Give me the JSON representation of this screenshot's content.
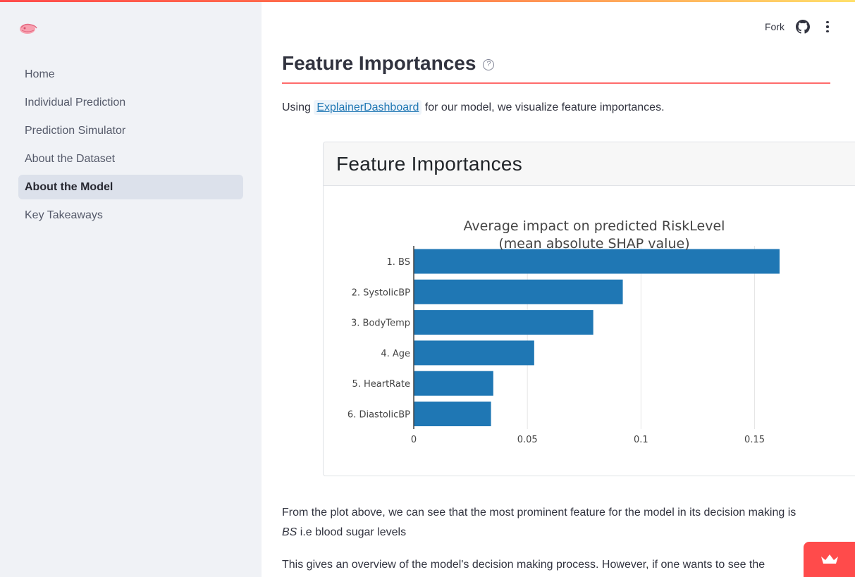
{
  "header": {
    "fork_label": "Fork"
  },
  "sidebar": {
    "items": [
      {
        "label": "Home",
        "active": false
      },
      {
        "label": "Individual Prediction",
        "active": false
      },
      {
        "label": "Prediction Simulator",
        "active": false
      },
      {
        "label": "About the Dataset",
        "active": false
      },
      {
        "label": "About the Model",
        "active": true
      },
      {
        "label": "Key Takeaways",
        "active": false
      }
    ]
  },
  "main": {
    "title": "Feature Importances",
    "help_glyph": "?",
    "intro_prefix": "Using",
    "intro_link": "ExplainerDashboard",
    "intro_suffix": "for our model, we visualize feature importances.",
    "card_title": "Feature Importances",
    "paragraph1_text": "From the plot above, we can see that the most prominent feature for the model in its decision making is",
    "paragraph1_em": "BS",
    "paragraph1_tail": "i.e blood sugar levels",
    "paragraph2": "This gives an overview of the model's decision making process. However, if one wants to see the"
  },
  "colors": {
    "accent": "#ff4b4b",
    "bar": "#1f77b4",
    "sidebar_bg": "#f0f2f6"
  },
  "chart_data": {
    "type": "bar",
    "orientation": "horizontal",
    "title": "Average impact on predicted RiskLevel",
    "subtitle": "(mean absolute SHAP value)",
    "categories": [
      "1. BS",
      "2. SystolicBP",
      "3. BodyTemp",
      "4. Age",
      "5. HeartRate",
      "6. DiastolicBP"
    ],
    "values": [
      0.161,
      0.092,
      0.079,
      0.053,
      0.035,
      0.034
    ],
    "xlim": [
      0,
      0.17
    ],
    "xticks": [
      0,
      0.05,
      0.1,
      0.15
    ],
    "xtick_labels": [
      "0",
      "0.05",
      "0.1",
      "0.15"
    ],
    "grid": true,
    "legend": "none"
  }
}
